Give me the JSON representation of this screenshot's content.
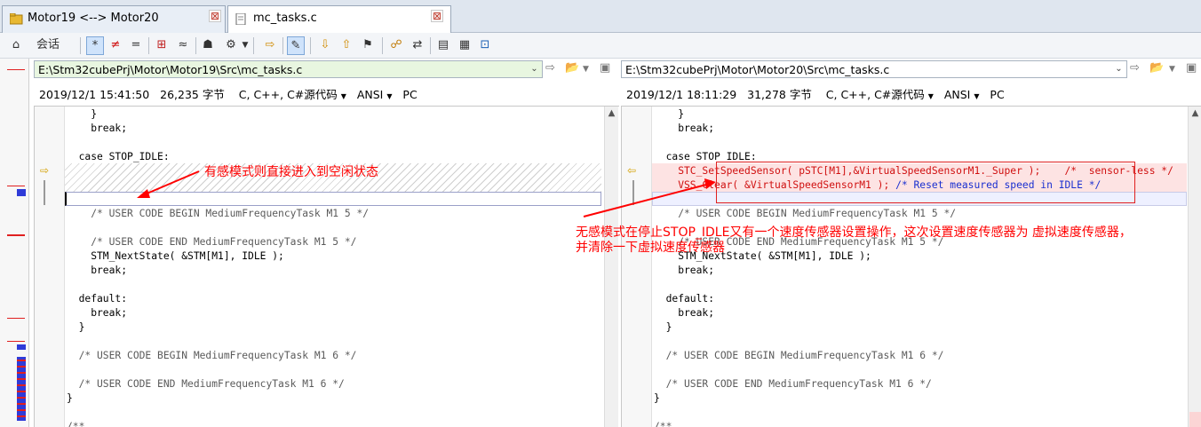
{
  "tabs": [
    {
      "label": "Motor19 <--> Motor20",
      "close": "⊠"
    },
    {
      "label": "mc_tasks.c",
      "close": "⊠"
    }
  ],
  "toolbar": {
    "session_label": "会话",
    "buttons": [
      "⌂",
      "*",
      "≠",
      "=",
      "⊞",
      "≈",
      "☗",
      "⚙",
      "⇨",
      "✎",
      "⇩",
      "⇧",
      "⚑",
      "☍",
      "⇄",
      "▤",
      "▦",
      "⊡"
    ]
  },
  "left": {
    "path": "E:\\Stm32cubePrj\\Motor\\Motor19\\Src\\mc_tasks.c",
    "info": {
      "date": "2019/12/1 15:41:50",
      "size": "26,235 字节",
      "lang": "C, C++, C#源代码",
      "encoding": "ANSI",
      "lineend": "PC"
    },
    "lines": [
      {
        "text": "    }",
        "cls": ""
      },
      {
        "text": "    break;",
        "cls": ""
      },
      {
        "text": "",
        "cls": ""
      },
      {
        "text": "  case STOP_IDLE:",
        "cls": ""
      },
      {
        "text": "",
        "cls": ""
      },
      {
        "text": "",
        "cls": ""
      },
      {
        "text": "",
        "cls": ""
      },
      {
        "text": "    /* USER CODE BEGIN MediumFrequencyTask M1 5 */",
        "cls": "cm"
      },
      {
        "text": "",
        "cls": ""
      },
      {
        "text": "    /* USER CODE END MediumFrequencyTask M1 5 */",
        "cls": "cm"
      },
      {
        "text": "    STM_NextState( &STM[M1], IDLE );",
        "cls": ""
      },
      {
        "text": "    break;",
        "cls": ""
      },
      {
        "text": "",
        "cls": ""
      },
      {
        "text": "  default:",
        "cls": ""
      },
      {
        "text": "    break;",
        "cls": ""
      },
      {
        "text": "  }",
        "cls": ""
      },
      {
        "text": "",
        "cls": ""
      },
      {
        "text": "  /* USER CODE BEGIN MediumFrequencyTask M1 6 */",
        "cls": "cm"
      },
      {
        "text": "",
        "cls": ""
      },
      {
        "text": "  /* USER CODE END MediumFrequencyTask M1 6 */",
        "cls": "cm"
      },
      {
        "text": "}",
        "cls": ""
      },
      {
        "text": "",
        "cls": ""
      },
      {
        "text": "/**",
        "cls": "cm"
      }
    ]
  },
  "right": {
    "path": "E:\\Stm32cubePrj\\Motor\\Motor20\\Src\\mc_tasks.c",
    "info": {
      "date": "2019/12/1 18:11:29",
      "size": "31,278 字节",
      "lang": "C, C++, C#源代码",
      "encoding": "ANSI",
      "lineend": "PC"
    },
    "lines": [
      {
        "text": "    }",
        "cls": ""
      },
      {
        "text": "    break;",
        "cls": ""
      },
      {
        "text": "",
        "cls": ""
      },
      {
        "text": "  case STOP_IDLE:",
        "cls": ""
      },
      {
        "text": "    STC_SetSpeedSensor( pSTC[M1],&VirtualSpeedSensorM1._Super );    /*  sensor-less */",
        "cls": "diff"
      },
      {
        "text": "    VSS_Clear( &VirtualSpeedSensorM1 ); ",
        "cls": "diff",
        "tail": "/* Reset measured speed in IDLE */"
      },
      {
        "text": "",
        "cls": ""
      },
      {
        "text": "    /* USER CODE BEGIN MediumFrequencyTask M1 5 */",
        "cls": "cm"
      },
      {
        "text": "",
        "cls": ""
      },
      {
        "text": "    /* USER CODE END MediumFrequencyTask M1 5 */",
        "cls": "cm"
      },
      {
        "text": "    STM_NextState( &STM[M1], IDLE );",
        "cls": ""
      },
      {
        "text": "    break;",
        "cls": ""
      },
      {
        "text": "",
        "cls": ""
      },
      {
        "text": "  default:",
        "cls": ""
      },
      {
        "text": "    break;",
        "cls": ""
      },
      {
        "text": "  }",
        "cls": ""
      },
      {
        "text": "",
        "cls": ""
      },
      {
        "text": "  /* USER CODE BEGIN MediumFrequencyTask M1 6 */",
        "cls": "cm"
      },
      {
        "text": "",
        "cls": ""
      },
      {
        "text": "  /* USER CODE END MediumFrequencyTask M1 6 */",
        "cls": "cm"
      },
      {
        "text": "}",
        "cls": ""
      },
      {
        "text": "",
        "cls": ""
      },
      {
        "text": "/**",
        "cls": "cm"
      }
    ]
  },
  "annotations": {
    "left_note": "有感模式则直接进入到空闲状态",
    "right_note_line1": "无感模式在停止STOP_IDLE又有一个速度传感器设置操作，这次设置速度传感器为 虚拟速度传感器，",
    "right_note_line2": "并清除一下虚拟速度传感器"
  },
  "colors": {
    "diff_text": "#d01010",
    "comment": "#5a5a5a",
    "annotation": "#ff0000",
    "left_path_bg": "#e8f6e0"
  }
}
